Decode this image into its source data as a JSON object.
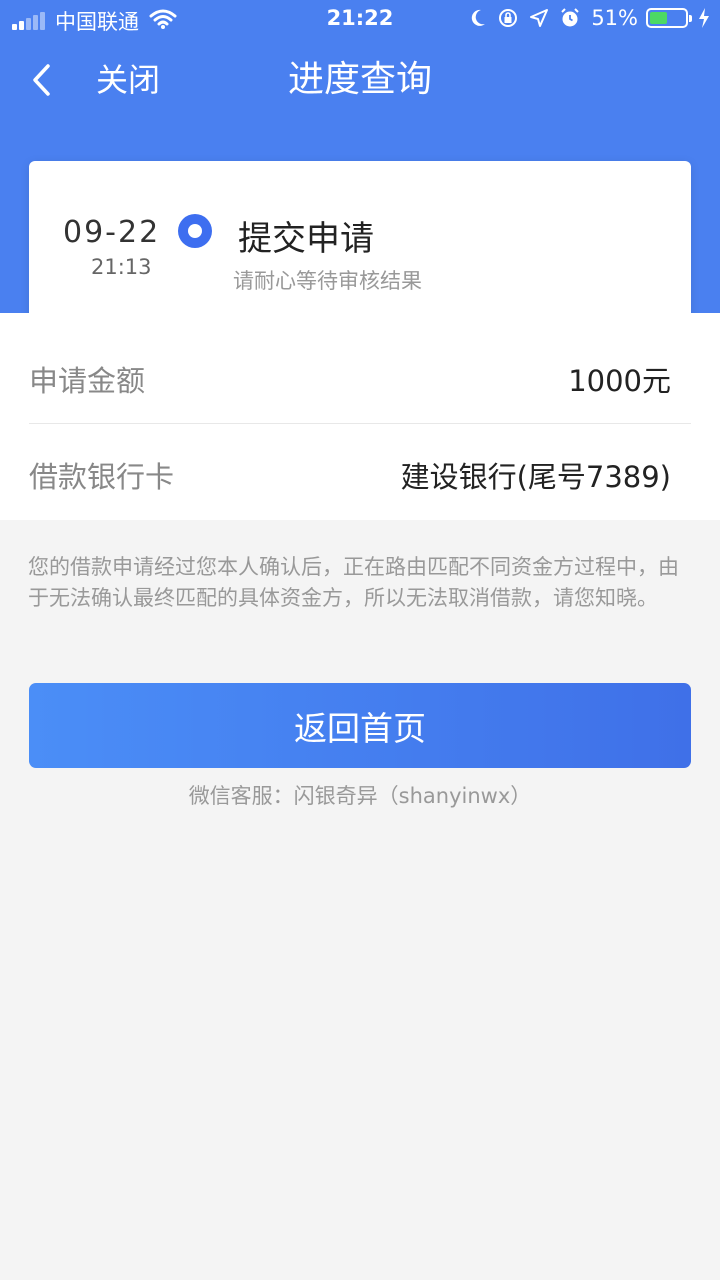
{
  "status_bar": {
    "carrier": "中国联通",
    "time": "21:22",
    "battery_percent": "51%",
    "battery_level": 0.51,
    "icons": [
      "signal-icon",
      "wifi-icon",
      "moon-icon",
      "rotation-lock-icon",
      "location-icon",
      "alarm-icon",
      "battery-icon",
      "charging-icon"
    ]
  },
  "navbar": {
    "close_label": "关闭",
    "title": "进度查询"
  },
  "progress": {
    "date": "09-22",
    "time": "21:13",
    "step_title": "提交申请",
    "step_subtitle": "请耐心等待审核结果"
  },
  "info": {
    "amount_label": "申请金额",
    "amount_value": "1000元",
    "card_label": "借款银行卡",
    "card_value": "建设银行(尾号7389)"
  },
  "notice": "您的借款申请经过您本人确认后，正在路由匹配不同资金方过程中，由于无法确认最终匹配的具体资金方，所以无法取消借款，请您知晓。",
  "button": {
    "home_label": "返回首页"
  },
  "service": {
    "text": "微信客服：闪银奇异（shanyinwx）"
  },
  "colors": {
    "brand_blue": "#4a80f0",
    "button_start": "#4b8ef7",
    "button_end": "#3f70e8",
    "battery_green": "#4cd964"
  }
}
